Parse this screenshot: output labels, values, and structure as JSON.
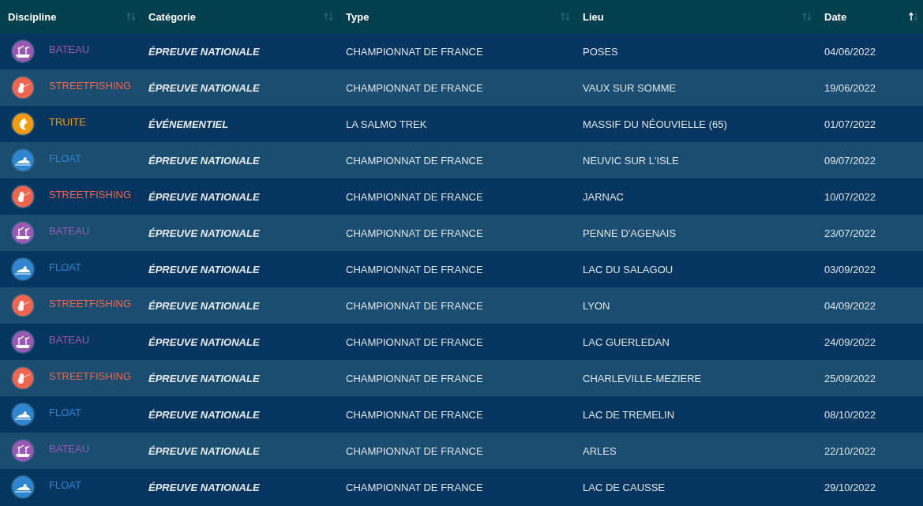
{
  "table": {
    "columns": [
      {
        "label": "Discipline",
        "sorted": false
      },
      {
        "label": "Catégorie",
        "sorted": false
      },
      {
        "label": "Type",
        "sorted": false
      },
      {
        "label": "Lieu",
        "sorted": false
      },
      {
        "label": "Date",
        "sorted": true
      }
    ],
    "rows": [
      {
        "discipline": "BATEAU",
        "kind": "boat",
        "color": "#9b59b6",
        "category": "ÉPREUVE NATIONALE",
        "type": "CHAMPIONNAT DE FRANCE",
        "place": "POSES",
        "date": "04/06/2022"
      },
      {
        "discipline": "STREETFISHING",
        "kind": "street",
        "color": "#ef6650",
        "category": "ÉPREUVE NATIONALE",
        "type": "CHAMPIONNAT DE FRANCE",
        "place": "VAUX SUR SOMME",
        "date": "19/06/2022"
      },
      {
        "discipline": "TRUITE",
        "kind": "trout",
        "color": "#f39c12",
        "category": "ÉVÉNEMENTIEL",
        "type": "LA SALMO TREK",
        "place": "MASSIF DU NÉOUVIELLE (65)",
        "date": "01/07/2022"
      },
      {
        "discipline": "FLOAT",
        "kind": "float",
        "color": "#2e86d1",
        "category": "ÉPREUVE NATIONALE",
        "type": "CHAMPIONNAT DE FRANCE",
        "place": "NEUVIC SUR L'ISLE",
        "date": "09/07/2022"
      },
      {
        "discipline": "STREETFISHING",
        "kind": "street",
        "color": "#ef6650",
        "category": "ÉPREUVE NATIONALE",
        "type": "CHAMPIONNAT DE FRANCE",
        "place": "JARNAC",
        "date": "10/07/2022"
      },
      {
        "discipline": "BATEAU",
        "kind": "boat",
        "color": "#9b59b6",
        "category": "ÉPREUVE NATIONALE",
        "type": "CHAMPIONNAT DE FRANCE",
        "place": "PENNE D'AGENAIS",
        "date": "23/07/2022"
      },
      {
        "discipline": "FLOAT",
        "kind": "float",
        "color": "#2e86d1",
        "category": "ÉPREUVE NATIONALE",
        "type": "CHAMPIONNAT DE FRANCE",
        "place": "LAC DU SALAGOU",
        "date": "03/09/2022"
      },
      {
        "discipline": "STREETFISHING",
        "kind": "street",
        "color": "#ef6650",
        "category": "ÉPREUVE NATIONALE",
        "type": "CHAMPIONNAT DE FRANCE",
        "place": "LYON",
        "date": "04/09/2022"
      },
      {
        "discipline": "BATEAU",
        "kind": "boat",
        "color": "#9b59b6",
        "category": "ÉPREUVE NATIONALE",
        "type": "CHAMPIONNAT DE FRANCE",
        "place": "LAC GUERLEDAN",
        "date": "24/09/2022"
      },
      {
        "discipline": "STREETFISHING",
        "kind": "street",
        "color": "#ef6650",
        "category": "ÉPREUVE NATIONALE",
        "type": "CHAMPIONNAT DE FRANCE",
        "place": "CHARLEVILLE-MEZIERE",
        "date": "25/09/2022"
      },
      {
        "discipline": "FLOAT",
        "kind": "float",
        "color": "#2e86d1",
        "category": "ÉPREUVE NATIONALE",
        "type": "CHAMPIONNAT DE FRANCE",
        "place": "LAC DE TREMELIN",
        "date": "08/10/2022"
      },
      {
        "discipline": "BATEAU",
        "kind": "boat",
        "color": "#9b59b6",
        "category": "ÉPREUVE NATIONALE",
        "type": "CHAMPIONNAT DE FRANCE",
        "place": "ARLES",
        "date": "22/10/2022"
      },
      {
        "discipline": "FLOAT",
        "kind": "float",
        "color": "#2e86d1",
        "category": "ÉPREUVE NATIONALE",
        "type": "CHAMPIONNAT DE FRANCE",
        "place": "LAC DE CAUSSE",
        "date": "29/10/2022"
      }
    ]
  }
}
